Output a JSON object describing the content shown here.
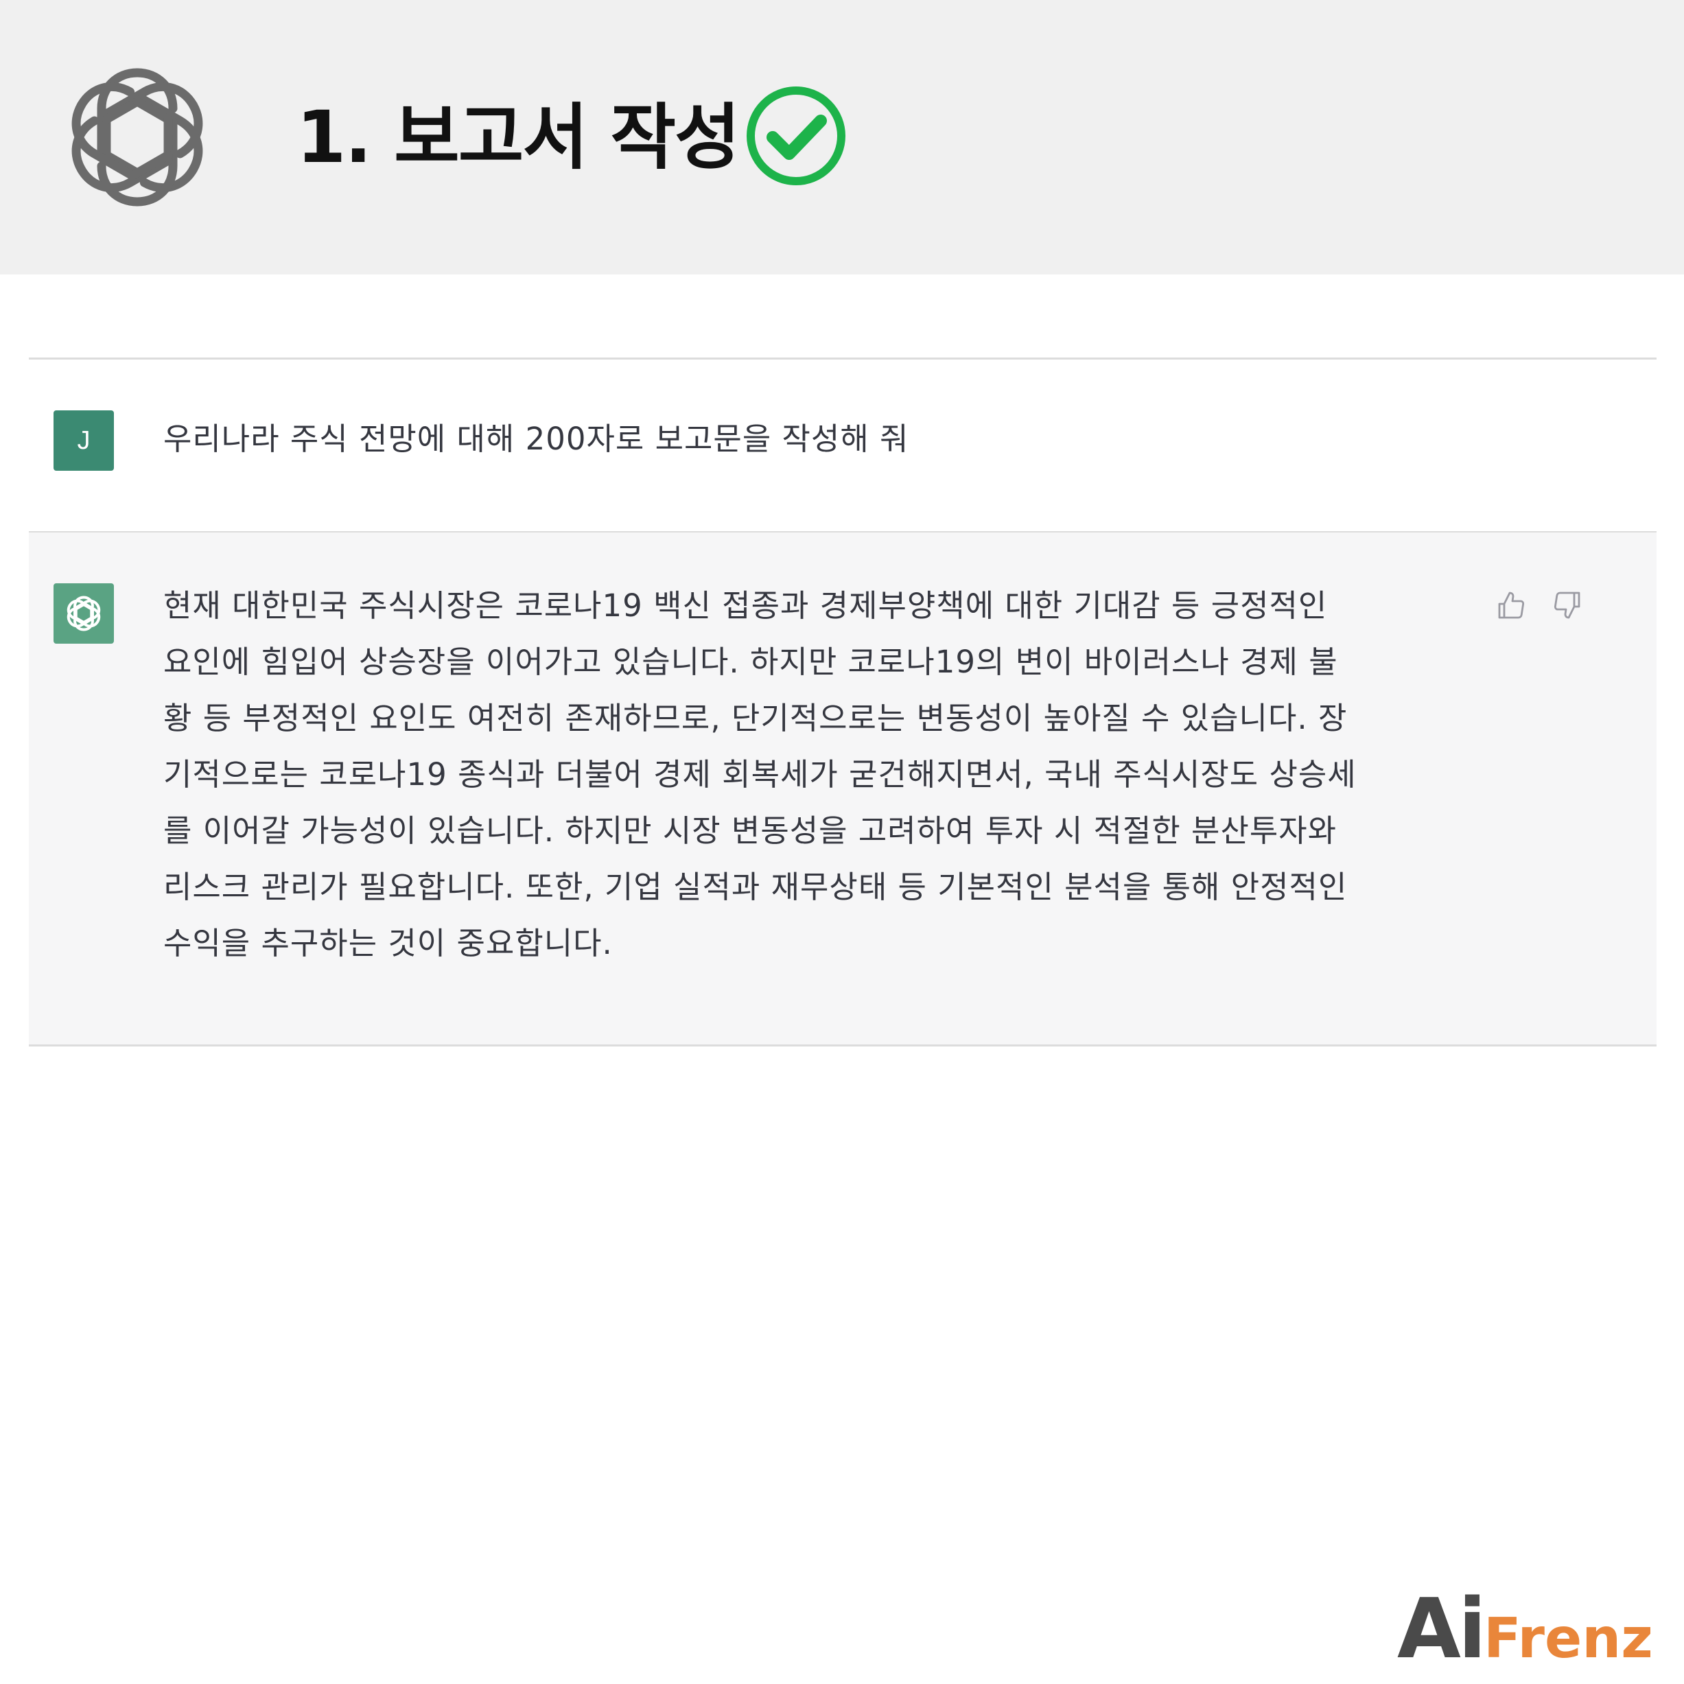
{
  "banner": {
    "title": "1. 보고서 작성",
    "logo_icon": "openai-logo-icon",
    "check_icon": "green-check-circle-icon",
    "check_color": "#1db34a",
    "background": "#f0f0f0"
  },
  "chat": {
    "user": {
      "avatar_letter": "J",
      "avatar_color": "#3b8a72",
      "message": "우리나라 주식 전망에 대해 200자로 보고문을 작성해 줘"
    },
    "assistant": {
      "avatar_icon": "openai-logo-icon",
      "avatar_color": "#5aa383",
      "lines": [
        "현재 대한민국 주식시장은 코로나19 백신 접종과 경제부양책에 대한 기대감 등 긍정적인",
        "요인에 힘입어 상승장을 이어가고 있습니다. 하지만 코로나19의 변이 바이러스나 경제 불",
        "황 등 부정적인 요인도 여전히 존재하므로, 단기적으로는 변동성이 높아질 수 있습니다. 장",
        "기적으로는 코로나19 종식과 더불어 경제 회복세가 굳건해지면서, 국내 주식시장도 상승세",
        "를 이어갈 가능성이 있습니다. 하지만 시장 변동성을 고려하여 투자 시 적절한 분산투자와",
        "리스크 관리가 필요합니다. 또한, 기업 실적과 재무상태 등 기본적인 분석을 통해 안정적인",
        "수익을 추구하는 것이 중요합니다."
      ],
      "feedback_icons": [
        "thumbs-up-icon",
        "thumbs-down-icon"
      ]
    }
  },
  "brand": {
    "ai": "Ai",
    "frenz": "Frenz",
    "ai_color": "#4a4a4a",
    "frenz_color": "#e9863a"
  }
}
